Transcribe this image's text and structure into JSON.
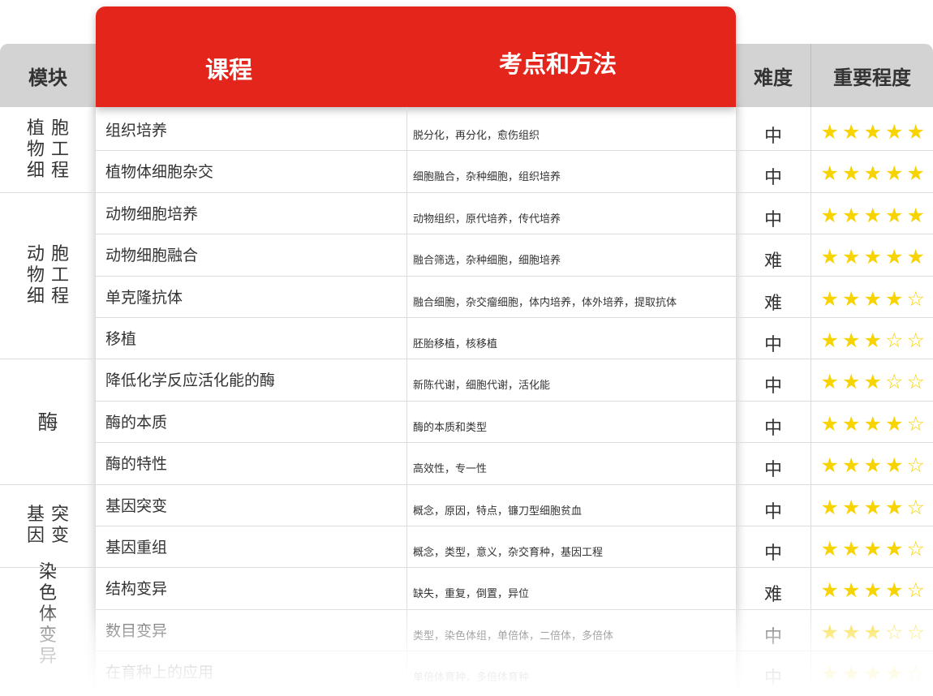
{
  "headers": {
    "module": "模块",
    "course": "课程",
    "points": "考点和方法",
    "difficulty": "难度",
    "importance": "重要程度"
  },
  "colors": {
    "accent": "#e3251b",
    "star": "#f7d300",
    "header_gray": "#d3d3d3"
  },
  "modules": [
    {
      "chars": [
        "植",
        "胞",
        "物",
        "工",
        "细",
        "程"
      ],
      "layout": "grid"
    },
    {
      "chars": [
        "动",
        "胞",
        "物",
        "工",
        "细",
        "程"
      ],
      "layout": "grid"
    },
    {
      "chars": [
        "酶"
      ],
      "layout": "single"
    },
    {
      "chars": [
        "基",
        "突",
        "因",
        "变"
      ],
      "layout": "grid"
    },
    {
      "chars": [
        "染",
        "色",
        "体",
        "变",
        "异"
      ],
      "layout": "column"
    }
  ],
  "rows": [
    {
      "course": "组织培养",
      "points": "脱分化，再分化，愈伤组织",
      "difficulty": "中",
      "stars": 5
    },
    {
      "course": "植物体细胞杂交",
      "points": "细胞融合，杂种细胞，组织培养",
      "difficulty": "中",
      "stars": 5
    },
    {
      "course": "动物细胞培养",
      "points": "动物组织，原代培养，传代培养",
      "difficulty": "中",
      "stars": 5
    },
    {
      "course": "动物细胞融合",
      "points": "融合筛选，杂种细胞，细胞培养",
      "difficulty": "难",
      "stars": 5
    },
    {
      "course": "单克隆抗体",
      "points": "融合细胞，杂交瘤细胞，体内培养，体外培养，提取抗体",
      "difficulty": "难",
      "stars": 4
    },
    {
      "course": "移植",
      "points": "胚胎移植，核移植",
      "difficulty": "中",
      "stars": 3
    },
    {
      "course": "降低化学反应活化能的酶",
      "points": "新陈代谢，细胞代谢，活化能",
      "difficulty": "中",
      "stars": 3
    },
    {
      "course": "酶的本质",
      "points": "酶的本质和类型",
      "difficulty": "中",
      "stars": 4
    },
    {
      "course": "酶的特性",
      "points": "高效性，专一性",
      "difficulty": "中",
      "stars": 4
    },
    {
      "course": "基因突变",
      "points": "概念，原因，特点，镰刀型细胞贫血",
      "difficulty": "中",
      "stars": 4
    },
    {
      "course": "基因重组",
      "points": "概念，类型，意义，杂交育种，基因工程",
      "difficulty": "中",
      "stars": 4
    },
    {
      "course": "结构变异",
      "points": "缺失，重复，倒置，异位",
      "difficulty": "难",
      "stars": 4
    },
    {
      "course": "数目变异",
      "points": "类型，染色体组，单倍体，二倍体，多倍体",
      "difficulty": "中",
      "stars": 3
    },
    {
      "course": "在育种上的应用",
      "points": "单倍体育种，多倍体育种",
      "difficulty": "中",
      "stars": 4
    }
  ]
}
